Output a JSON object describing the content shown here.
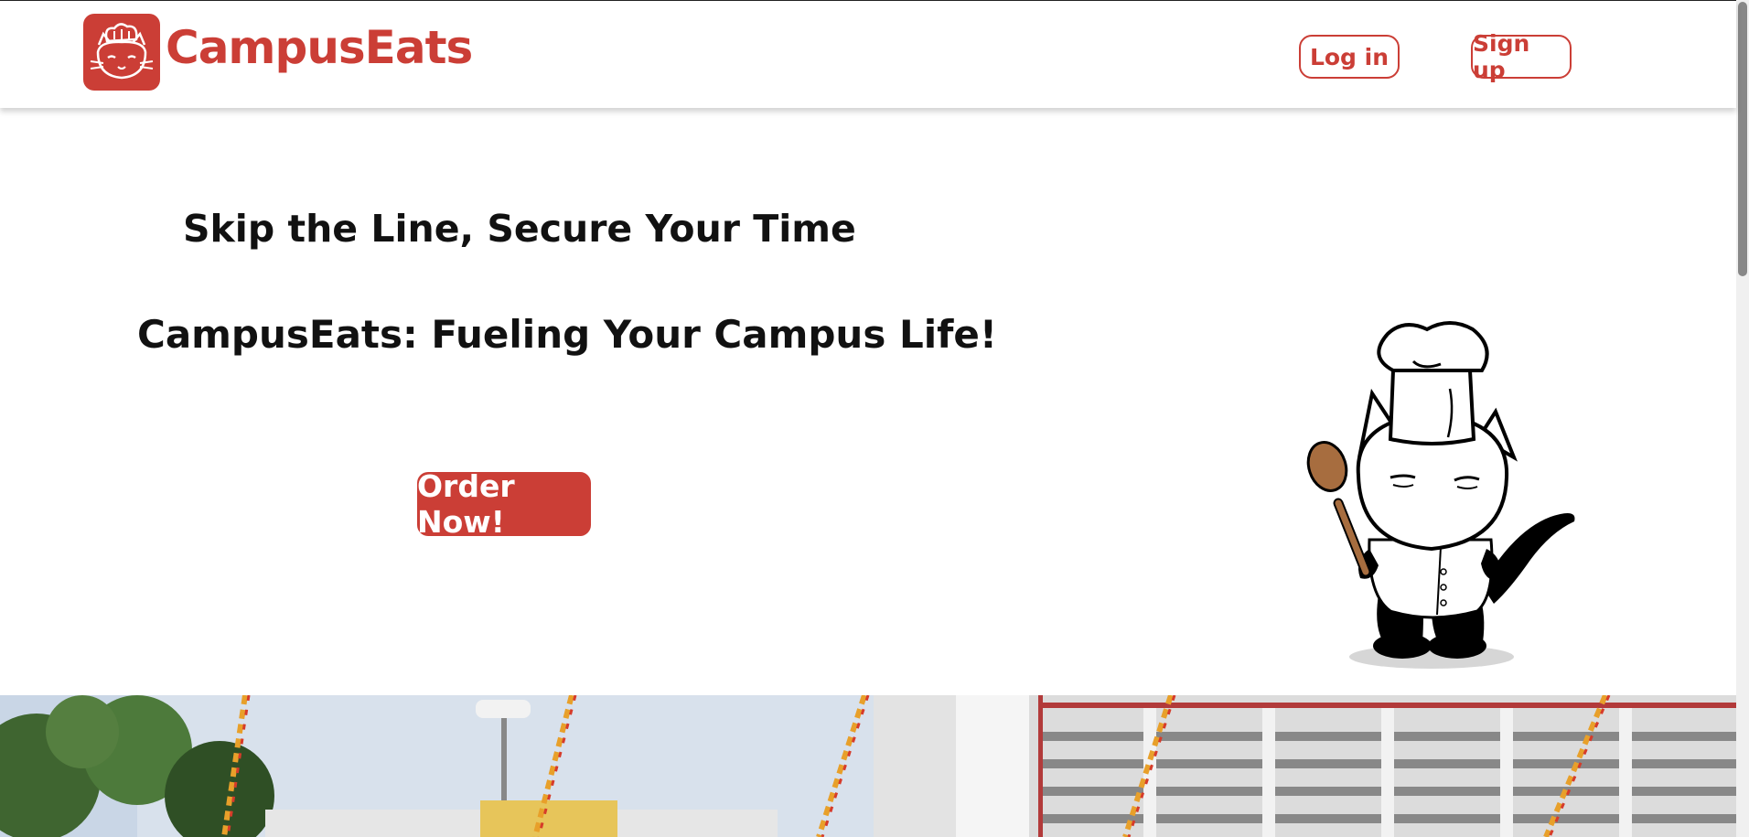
{
  "header": {
    "brand_name": "CampusEats",
    "login_label": "Log in",
    "signup_label": "Sign up"
  },
  "hero": {
    "tagline": "Skip the Line, Secure Your Time",
    "subtitle": "CampusEats: Fueling Your Campus Life!",
    "cta_label": "Order Now!"
  },
  "colors": {
    "brand_red": "#cb3e36",
    "text_dark": "#111111",
    "background": "#ffffff"
  },
  "icons": {
    "logo": "cat-chef-logo-icon",
    "mascot": "cat-chef-mascot-illustration"
  }
}
